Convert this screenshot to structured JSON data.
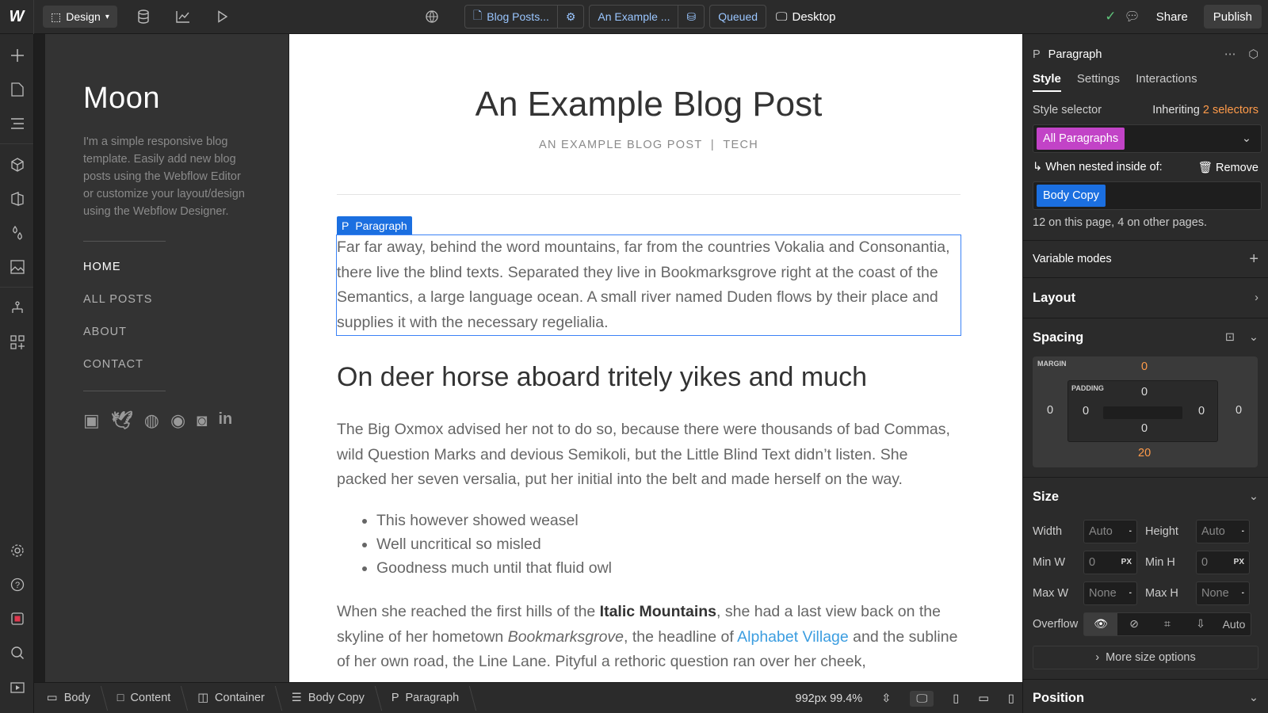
{
  "topbar": {
    "logo": "W",
    "design_label": "Design",
    "page_name": "Blog Posts...",
    "collection_item": "An Example ...",
    "status": "Queued",
    "breakpoint": "Desktop",
    "share": "Share",
    "publish": "Publish"
  },
  "site": {
    "title": "Moon",
    "description": "I'm a simple responsive blog template. Easily add new blog posts using the Webflow Editor or customize your layout/design using the Webflow Designer.",
    "nav": [
      "HOME",
      "ALL POSTS",
      "ABOUT",
      "CONTACT"
    ]
  },
  "post": {
    "title": "An Example Blog Post",
    "meta": "AN EXAMPLE BLOG POST  |  TECH",
    "selected_tag": "Paragraph",
    "tag_letter": "P",
    "p1": "Far far away, behind the word mountains, far from the countries Vokalia and Consonantia, there live the blind texts. Separated they live in Bookmarksgrove right at the coast of the Semantics, a large language ocean. A small river named Duden flows by their place and supplies it with the necessary regelialia.",
    "h2": "On deer horse aboard tritely yikes and much",
    "p2": "The Big Oxmox advised her not to do so, because there were thousands of bad Commas, wild Question Marks and devious Semikoli, but the Little Blind Text didn’t listen. She packed her seven versalia, put her initial into the belt and made herself on the way.",
    "list": [
      "This however showed weasel",
      "Well uncritical so misled",
      "Goodness much until that fluid owl"
    ],
    "p3_a": "When she reached the first hills of the ",
    "p3_bold": "Italic Mountains",
    "p3_b": ", she had a last view back on the skyline of her hometown ",
    "p3_italic": "Bookmarksgrove",
    "p3_c": ", the headline of ",
    "p3_link": "Alphabet Village",
    "p3_d": " and the subline of her own road, the Line Lane. Pityful a rethoric question ran over her cheek,"
  },
  "breadcrumb": [
    "Body",
    "Content",
    "Container",
    "Body Copy",
    "Paragraph"
  ],
  "canvas_info": {
    "width_zoom": "992px 99.4%"
  },
  "panel": {
    "element": "Paragraph",
    "element_letter": "P",
    "tabs": [
      "Style",
      "Settings",
      "Interactions"
    ],
    "style_selector_label": "Style selector",
    "inheriting_label": "Inheriting",
    "inheriting_count": "2 selectors",
    "chip_primary": "All Paragraphs",
    "nested_label": "When nested inside of:",
    "remove_label": "Remove",
    "chip_nested": "Body Copy",
    "usage": "12 on this page, 4 on other pages.",
    "variable_modes": "Variable modes",
    "layout": "Layout",
    "spacing": "Spacing",
    "margin_label": "MARGIN",
    "padding_label": "PADDING",
    "margin": {
      "top": "0",
      "right": "0",
      "bottom": "20",
      "left": "0"
    },
    "padding": {
      "top": "0",
      "right": "0",
      "bottom": "0",
      "left": "0"
    },
    "size": "Size",
    "width_label": "Width",
    "width_value": "Auto",
    "height_label": "Height",
    "height_value": "Auto",
    "minw_label": "Min W",
    "minw_value": "0",
    "minh_label": "Min H",
    "minh_value": "0",
    "unit": "PX",
    "maxw_label": "Max W",
    "maxw_value": "None",
    "maxh_label": "Max H",
    "maxh_value": "None",
    "dash": "-",
    "overflow_label": "Overflow",
    "overflow_auto": "Auto",
    "more_size": "More size options",
    "position": "Position"
  },
  "colors": {
    "accent": "#1b6fe0",
    "chip_primary": "#c243c7",
    "chip_nested": "#1b6fe0",
    "orange": "#ff9b4a",
    "link": "#3b9de0"
  }
}
